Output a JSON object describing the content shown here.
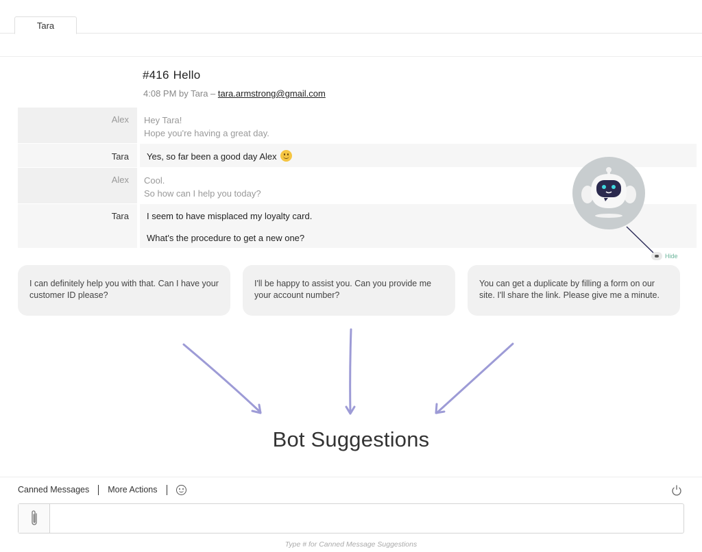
{
  "tabs": [
    {
      "label": "Tara"
    }
  ],
  "ticket": {
    "number": "#416",
    "subject": "Hello",
    "meta_prefix": "4:08 PM by Tara – ",
    "email": "tara.armstrong@gmail.com"
  },
  "messages": [
    {
      "sender": "Alex",
      "lines": [
        "Hey Tara!",
        "Hope you're having a great day."
      ]
    },
    {
      "sender": "Tara",
      "lines": [
        "Yes, so far been a good day Alex"
      ],
      "emoji": "smiling-face"
    },
    {
      "sender": "Alex",
      "lines": [
        "Cool.",
        "So how can I help you today?"
      ]
    },
    {
      "sender": "Tara",
      "lines": [
        "I seem to have misplaced my loyalty card.",
        "What's the procedure to get a new one?"
      ]
    }
  ],
  "bot": {
    "hide_label": "Hide",
    "avatar_icon": "robot-icon"
  },
  "suggestions": [
    {
      "text": "I can definitely help you with that. Can I have your customer ID please?"
    },
    {
      "text": "I'll be happy to assist you. Can you provide me your account number?"
    },
    {
      "text": "You can get a duplicate by filling a form on our site. I'll share the link. Please give me a minute."
    }
  ],
  "annotation": {
    "label": "Bot Suggestions",
    "arrow_color": "#9d9bd6"
  },
  "composer": {
    "canned_label": "Canned Messages",
    "more_label": "More Actions",
    "placeholder": "",
    "hint": "Type # for Canned Message Suggestions"
  },
  "colors": {
    "accent_green": "#6bb49a",
    "bubble_bg": "#f1f1f1"
  }
}
